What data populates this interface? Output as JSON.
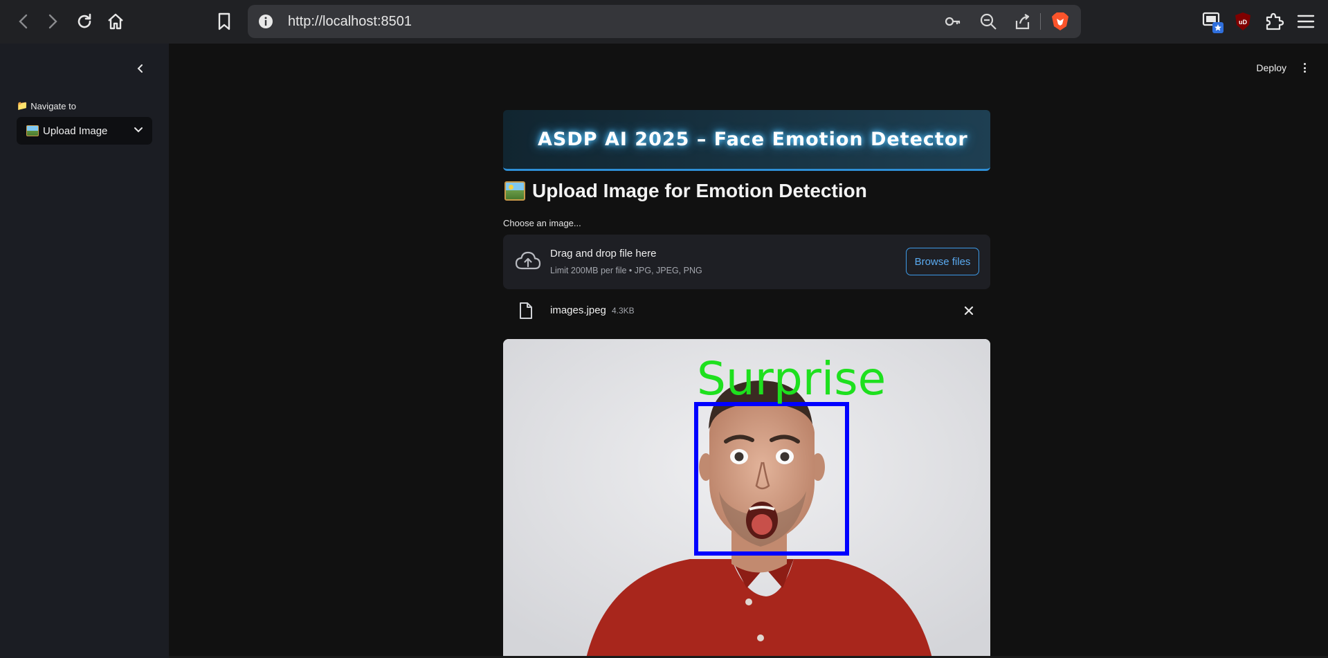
{
  "browser": {
    "url": "http://localhost:8501"
  },
  "sidebar": {
    "nav_label": "Navigate to",
    "nav_emoji": "📁",
    "selected_page": "Upload Image"
  },
  "header": {
    "deploy_label": "Deploy"
  },
  "main": {
    "banner_title": "ASDP AI 2025 – Face Emotion Detector",
    "heading": "Upload Image for Emotion Detection",
    "uploader_label": "Choose an image...",
    "dropzone_title": "Drag and drop file here",
    "dropzone_sub": "Limit 200MB per file • JPG, JPEG, PNG",
    "browse_label": "Browse files",
    "file_name": "images.jpeg",
    "file_size": "4.3KB"
  },
  "result": {
    "emotion_label": "Surprise",
    "label_color": "#1ee01e",
    "box_color": "#0000ff"
  },
  "colors": {
    "accent": "#3d9be9",
    "banner_glow": "#58c8ff"
  }
}
